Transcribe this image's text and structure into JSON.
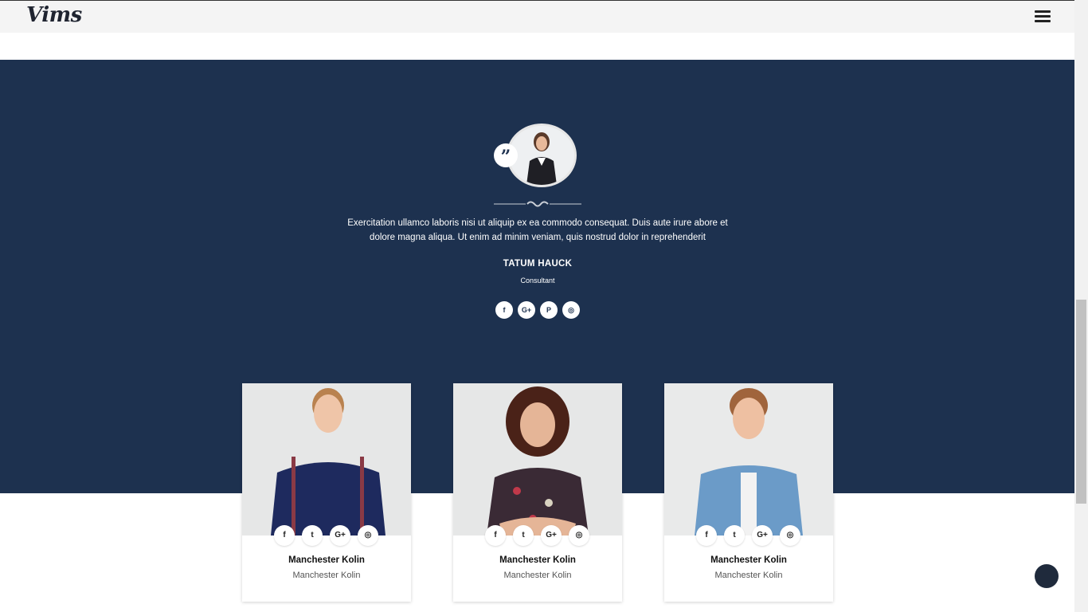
{
  "header": {
    "logo": "Vims"
  },
  "testimonial": {
    "text": "Exercitation ullamco laboris nisi ut aliquip ex ea commodo consequat. Duis aute irure abore et dolore magna aliqua. Ut enim ad minim veniam, quis nostrud dolor in reprehenderit",
    "name": "TATUM HAUCK",
    "role": "Consultant",
    "social_icons": [
      "facebook-icon",
      "google-plus-icon",
      "pinterest-icon",
      "instagram-icon"
    ]
  },
  "team": [
    {
      "name": "Manchester Kolin",
      "role": "Manchester Kolin",
      "shirt_color": "#1e2a5e"
    },
    {
      "name": "Manchester Kolin",
      "role": "Manchester Kolin",
      "shirt_color": "#3a2a35"
    },
    {
      "name": "Manchester Kolin",
      "role": "Manchester Kolin",
      "shirt_color": "#6b9bc8"
    }
  ],
  "card_social_icons": [
    "facebook-icon",
    "twitter-icon",
    "google-plus-icon",
    "instagram-icon"
  ],
  "colors": {
    "navy": "#1d314f",
    "header_bg": "#f4f4f4",
    "chat_button": "#1f2a3c"
  }
}
